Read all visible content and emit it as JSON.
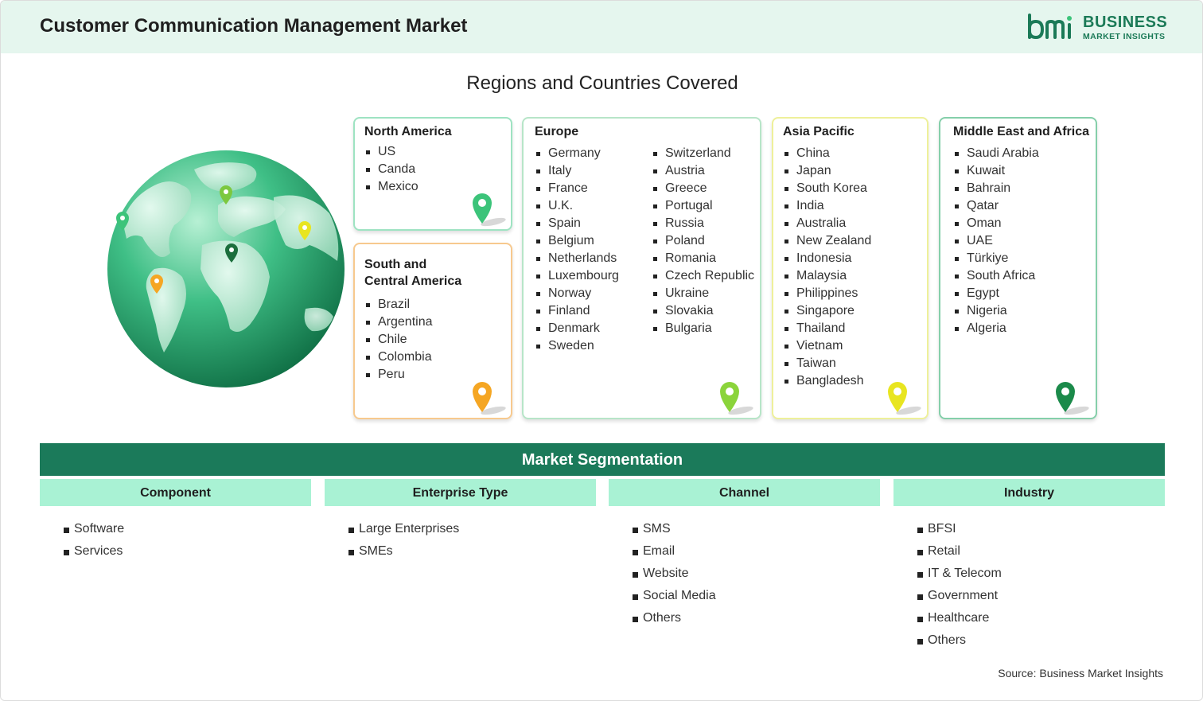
{
  "header": {
    "title": "Customer Communication Management Market",
    "logo_line1": "BUSINESS",
    "logo_line2": "MARKET INSIGHTS"
  },
  "regions_title": "Regions and Countries Covered",
  "regions": {
    "north_america": {
      "title": "North America",
      "items": [
        "US",
        "Canda",
        "Mexico"
      ],
      "pin_color": "#3cc47a"
    },
    "south_central_america": {
      "title_line1": "South and",
      "title_line2": "Central America",
      "items": [
        "Brazil",
        "Argentina",
        "Chile",
        "Colombia",
        "Peru"
      ],
      "pin_color": "#f5a623"
    },
    "europe": {
      "title": "Europe",
      "items_col1": [
        "Germany",
        "Italy",
        "France",
        "U.K.",
        "Spain",
        "Belgium",
        "Netherlands",
        "Luxembourg",
        "Norway",
        "Finland",
        "Denmark",
        "Sweden"
      ],
      "items_col2": [
        "Switzerland",
        "Austria",
        "Greece",
        "Portugal",
        "Russia",
        "Poland",
        "Romania",
        "Czech Republic",
        "Ukraine",
        "Slovakia",
        "Bulgaria"
      ],
      "pin_color": "#8bd43b"
    },
    "asia_pacific": {
      "title": "Asia Pacific",
      "items": [
        "China",
        "Japan",
        "South Korea",
        "India",
        "Australia",
        "New Zealand",
        "Indonesia",
        "Malaysia",
        "Philippines",
        "Singapore",
        "Thailand",
        "Vietnam",
        "Taiwan",
        "Bangladesh"
      ],
      "pin_color": "#e8e520"
    },
    "middle_east_africa": {
      "title": "Middle East and Africa",
      "items": [
        "Saudi Arabia",
        "Kuwait",
        "Bahrain",
        "Qatar",
        "Oman",
        "UAE",
        "Türkiye",
        "South Africa",
        "Egypt",
        "Nigeria",
        "Algeria"
      ],
      "pin_color": "#1b8a4a"
    }
  },
  "segmentation": {
    "title": "Market Segmentation",
    "columns": [
      {
        "title": "Component",
        "items": [
          "Software",
          "Services"
        ]
      },
      {
        "title": "Enterprise Type",
        "items": [
          "Large Enterprises",
          "SMEs"
        ]
      },
      {
        "title": "Channel",
        "items": [
          "SMS",
          "Email",
          "Website",
          "Social Media",
          "Others"
        ]
      },
      {
        "title": "Industry",
        "items": [
          "BFSI",
          "Retail",
          "IT & Telecom",
          "Government",
          "Healthcare",
          "Others"
        ]
      }
    ]
  },
  "source": "Source: Business Market Insights"
}
